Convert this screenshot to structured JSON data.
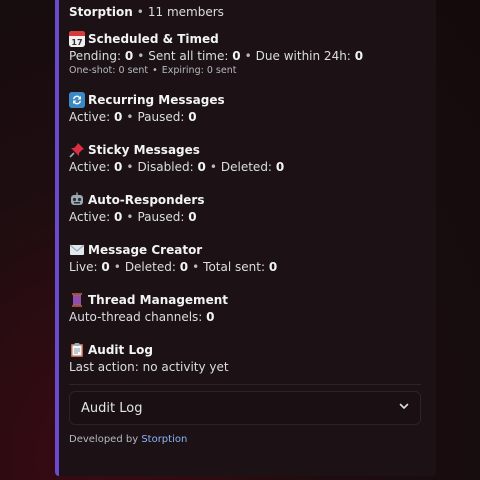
{
  "embed": {
    "server": "Storption",
    "members": "11 members",
    "sections": {
      "scheduled": {
        "title": "Scheduled & Timed",
        "pending_label": "Pending:",
        "pending": "0",
        "sent_label": "Sent all time:",
        "sent": "0",
        "due_label": "Due within 24h:",
        "due": "0",
        "oneshot": "One-shot: 0 sent",
        "expiring": "Expiring: 0 sent"
      },
      "recurring": {
        "title": "Recurring Messages",
        "active_label": "Active:",
        "active": "0",
        "paused_label": "Paused:",
        "paused": "0"
      },
      "sticky": {
        "title": "Sticky Messages",
        "active_label": "Active:",
        "active": "0",
        "disabled_label": "Disabled:",
        "disabled": "0",
        "deleted_label": "Deleted:",
        "deleted": "0"
      },
      "auto": {
        "title": "Auto-Responders",
        "active_label": "Active:",
        "active": "0",
        "paused_label": "Paused:",
        "paused": "0"
      },
      "creator": {
        "title": "Message Creator",
        "live_label": "Live:",
        "live": "0",
        "deleted_label": "Deleted:",
        "deleted": "0",
        "total_label": "Total sent:",
        "total": "0"
      },
      "thread": {
        "title": "Thread Management",
        "channels_label": "Auto-thread channels:",
        "channels": "0"
      },
      "audit": {
        "title": "Audit Log",
        "last": "Last action: no activity yet"
      }
    },
    "select_value": "Audit Log",
    "footer_prefix": "Developed by",
    "footer_link": "Storption"
  },
  "icons": {
    "scheduled": "calendar-icon",
    "recurring": "repeat-icon",
    "sticky": "pushpin-icon",
    "auto": "robot-icon",
    "creator": "envelope-icon",
    "thread": "thread-spool-icon",
    "audit": "clipboard-icon",
    "select": "chevron-down-icon"
  },
  "colors": {
    "accent_bar": "#6a4bd0",
    "link": "#8ab4f8"
  }
}
